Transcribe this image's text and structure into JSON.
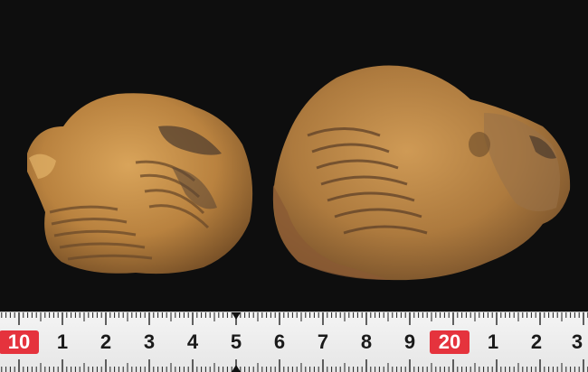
{
  "ruler": {
    "labels": [
      "10",
      "1",
      "2",
      "3",
      "4",
      "5",
      "6",
      "7",
      "8",
      "9",
      "20",
      "1",
      "2",
      "3"
    ],
    "highlight_color": "#e5333d",
    "cm_marker": "▲"
  },
  "photo": {
    "background_color": "#0e0e0e",
    "specimen_count": 2
  }
}
